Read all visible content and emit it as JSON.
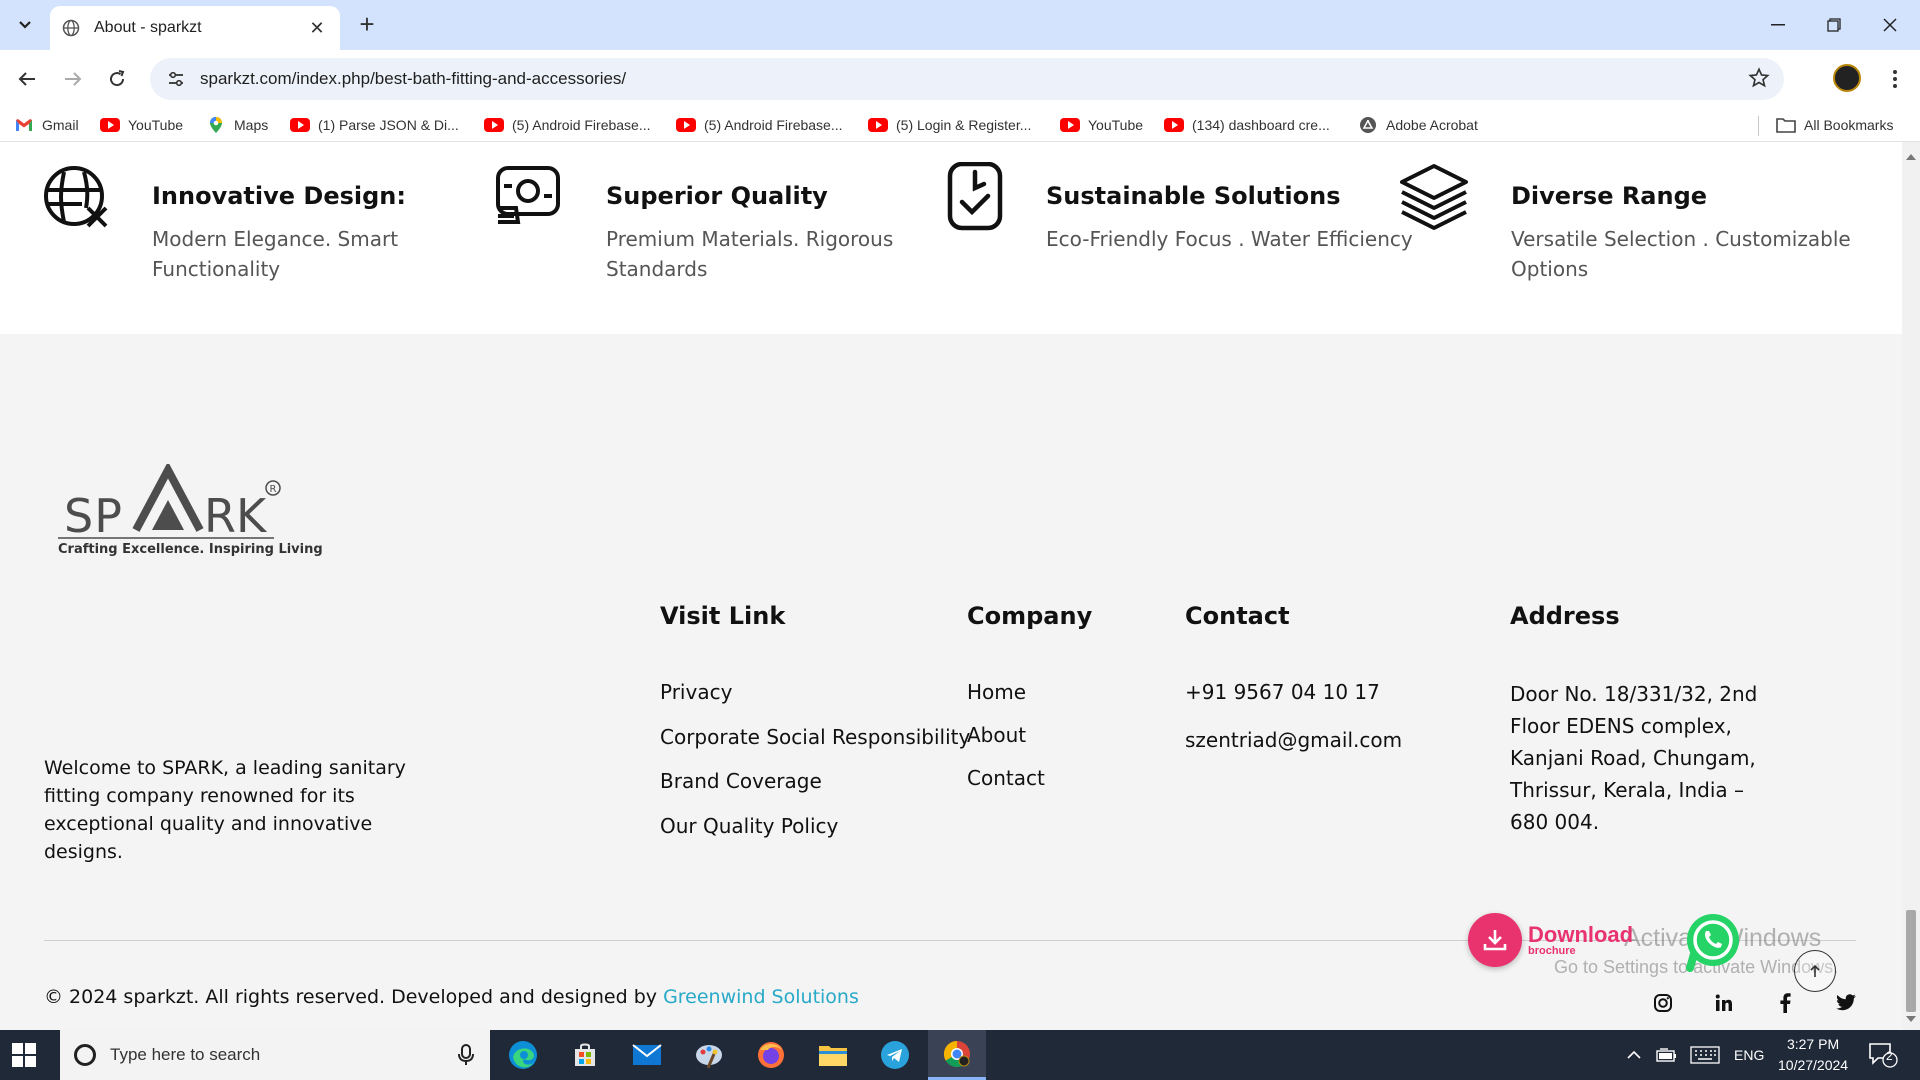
{
  "browser": {
    "tab_title": "About - sparkzt",
    "url": "sparkzt.com/index.php/best-bath-fitting-and-accessories/",
    "bookmarks": [
      {
        "label": "Gmail",
        "icon": "gmail-icon"
      },
      {
        "label": "YouTube",
        "icon": "youtube-icon"
      },
      {
        "label": "Maps",
        "icon": "maps-icon"
      },
      {
        "label": "(1) Parse JSON & Di...",
        "icon": "youtube-icon"
      },
      {
        "label": "(5) Android Firebase...",
        "icon": "youtube-icon"
      },
      {
        "label": "(5) Android Firebase...",
        "icon": "youtube-icon"
      },
      {
        "label": "(5) Login & Register...",
        "icon": "youtube-icon"
      },
      {
        "label": "YouTube",
        "icon": "youtube-icon"
      },
      {
        "label": "(134) dashboard cre...",
        "icon": "youtube-icon"
      },
      {
        "label": "Adobe Acrobat",
        "icon": "acrobat-icon"
      }
    ],
    "all_bookmarks": "All Bookmarks"
  },
  "features": [
    {
      "title": "Innovative Design:",
      "desc": "Modern Elegance. Smart Functionality",
      "icon": "globe-design-icon"
    },
    {
      "title": "Superior Quality",
      "desc": "Premium Materials. Rigorous Standards",
      "icon": "quality-badge-icon"
    },
    {
      "title": "Sustainable Solutions",
      "desc": "Eco-Friendly Focus . Water Efficiency",
      "icon": "clock-check-icon"
    },
    {
      "title": "Diverse Range",
      "desc": "Versatile Selection . Customizable Options",
      "icon": "layers-icon"
    }
  ],
  "footer": {
    "logo_text": "SPARK",
    "logo_tagline": "Crafting Excellence. Inspiring Living",
    "about": "Welcome to SPARK, a leading sanitary fitting company renowned for its exceptional quality and innovative designs.",
    "visit_link": {
      "heading": "Visit Link",
      "links": [
        "Privacy",
        "Corporate Social Responsibility",
        "Brand Coverage",
        "Our Quality Policy"
      ]
    },
    "company": {
      "heading": "Company",
      "links": [
        "Home",
        "About",
        "Contact"
      ]
    },
    "contact": {
      "heading": "Contact",
      "phone": "+91 9567 04 10 17",
      "email": "szentriad@gmail.com"
    },
    "address": {
      "heading": "Address",
      "text": "Door No. 18/331/32, 2nd Floor EDENS complex, Kanjani Road, Chungam, Thrissur, Kerala, India – 680 004."
    },
    "copyright_prefix": "© 2024 sparkzt. All rights reserved. Developed and designed by",
    "developer": "Greenwind Solutions",
    "social": [
      "instagram-icon",
      "linkedin-icon",
      "facebook-icon",
      "twitter-icon"
    ]
  },
  "floating": {
    "download_label": "Download",
    "download_sub": "brochure",
    "watermark_line1": "Activate Windows",
    "watermark_line2": "Go to Settings to activate Windows."
  },
  "taskbar": {
    "search_placeholder": "Type here to search",
    "lang": "ENG",
    "time": "3:27 PM",
    "date": "10/27/2024",
    "notifications": "2"
  },
  "colors": {
    "accent_link": "#27a9c8",
    "download_pink": "#e8336f",
    "whatsapp_green": "#25d366",
    "tabbar_blue": "#d3e3fd"
  }
}
